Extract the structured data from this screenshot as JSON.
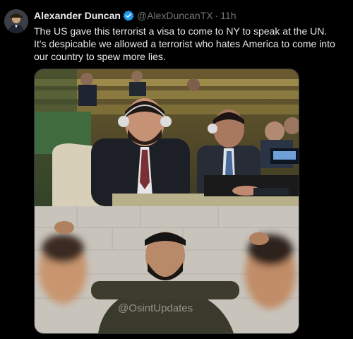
{
  "author": {
    "name": "Alexander Duncan",
    "handle": "@AlexDuncanTX",
    "time": "11h",
    "verified": true,
    "verified_color": "#1d9bf0"
  },
  "tweet": {
    "text": "The US gave this terrorist a visa to come to NY to speak at the UN. It's despicable we allowed a terrorist who hates America to come into our country to spew more lies."
  },
  "media": {
    "watermark": "@OsintUpdates"
  },
  "icons": {
    "verified": "verified-badge-icon"
  }
}
